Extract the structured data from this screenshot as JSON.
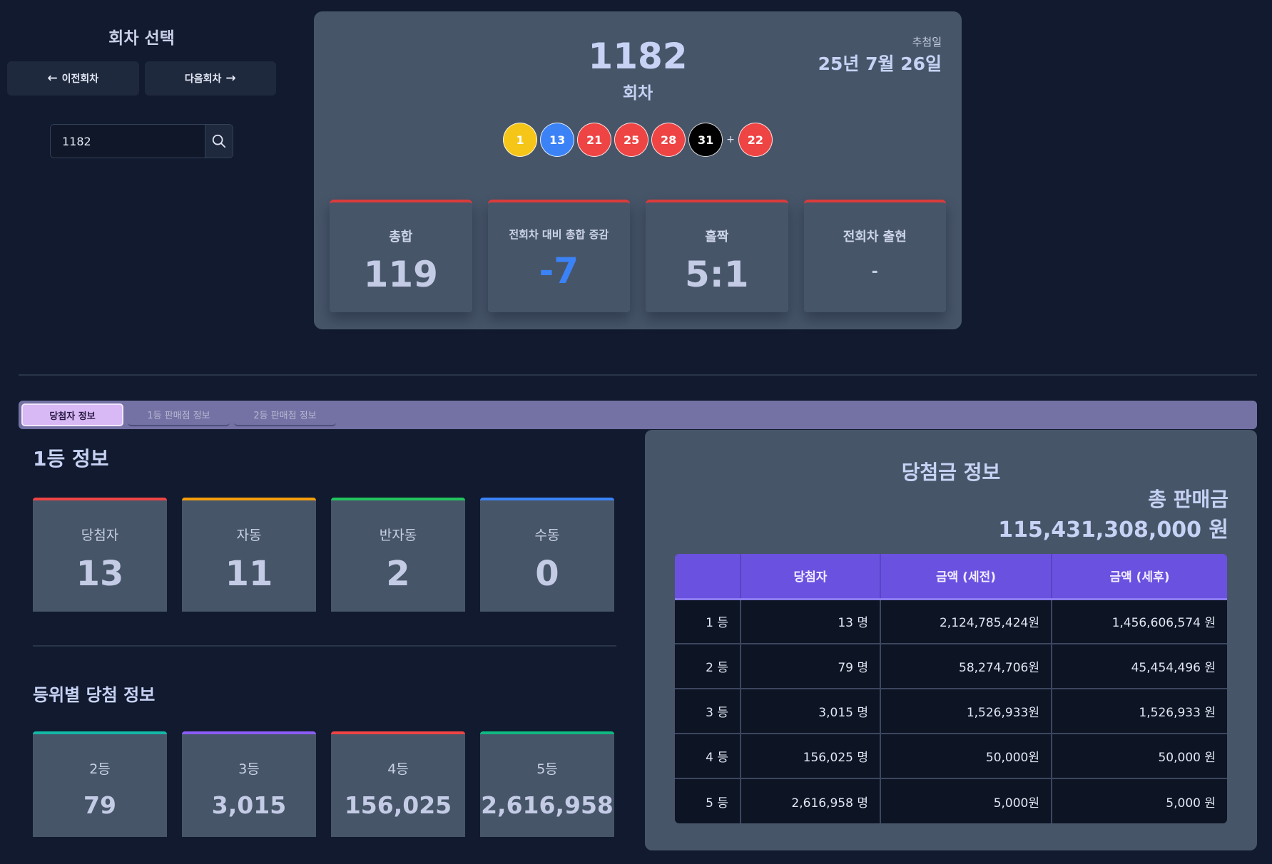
{
  "selector": {
    "title": "회차 선택",
    "prev_label": "이전회차",
    "next_label": "다음회차",
    "search_value": "1182"
  },
  "draw": {
    "round": "1182",
    "round_suffix": "회차",
    "date_label": "추첨일",
    "date": "25년 7월 26일",
    "balls": [
      {
        "number": "1",
        "color": "#f5c518"
      },
      {
        "number": "13",
        "color": "#3b82f6"
      },
      {
        "number": "21",
        "color": "#ef4444"
      },
      {
        "number": "25",
        "color": "#ef4444"
      },
      {
        "number": "28",
        "color": "#ef4444"
      },
      {
        "number": "31",
        "color": "#000000"
      }
    ],
    "plus": "+",
    "bonus": {
      "number": "22",
      "color": "#ef4444"
    },
    "stats": [
      {
        "label": "총합",
        "value": "119"
      },
      {
        "label": "전회차 대비 총합 증감",
        "value": "-7"
      },
      {
        "label": "홀짝",
        "value": "5:1"
      },
      {
        "label": "전회차 출현",
        "value": "-"
      }
    ]
  },
  "tabs": [
    "당첨자 정보",
    "1등 판매점 정보",
    "2등 판매점 정보"
  ],
  "first_prize": {
    "title": "1등 정보",
    "cards": [
      {
        "label": "당첨자",
        "value": "13",
        "accent": "#ef4444"
      },
      {
        "label": "자동",
        "value": "11",
        "accent": "#f59e0b"
      },
      {
        "label": "반자동",
        "value": "2",
        "accent": "#22c55e"
      },
      {
        "label": "수동",
        "value": "0",
        "accent": "#3b82f6"
      }
    ]
  },
  "rank_info": {
    "title": "등위별 당첨 정보",
    "cards": [
      {
        "label": "2등",
        "value": "79",
        "accent": "#14b8a6"
      },
      {
        "label": "3등",
        "value": "3,015",
        "accent": "#8b5cf6"
      },
      {
        "label": "4등",
        "value": "156,025",
        "accent": "#ef4444"
      },
      {
        "label": "5등",
        "value": "2,616,958",
        "accent": "#10b981"
      }
    ]
  },
  "prize_info": {
    "title": "당첨금 정보",
    "sales_label": "총 판매금",
    "sales_value": "115,431,308,000 원",
    "headers": [
      "",
      "당첨자",
      "금액 (세전)",
      "금액 (세후)"
    ],
    "rows": [
      [
        "1 등",
        "13 명",
        "2,124,785,424원",
        "1,456,606,574 원"
      ],
      [
        "2 등",
        "79 명",
        "58,274,706원",
        "45,454,496 원"
      ],
      [
        "3 등",
        "3,015 명",
        "1,526,933원",
        "1,526,933 원"
      ],
      [
        "4 등",
        "156,025 명",
        "50,000원",
        "50,000 원"
      ],
      [
        "5 등",
        "2,616,958 명",
        "5,000원",
        "5,000 원"
      ]
    ]
  }
}
